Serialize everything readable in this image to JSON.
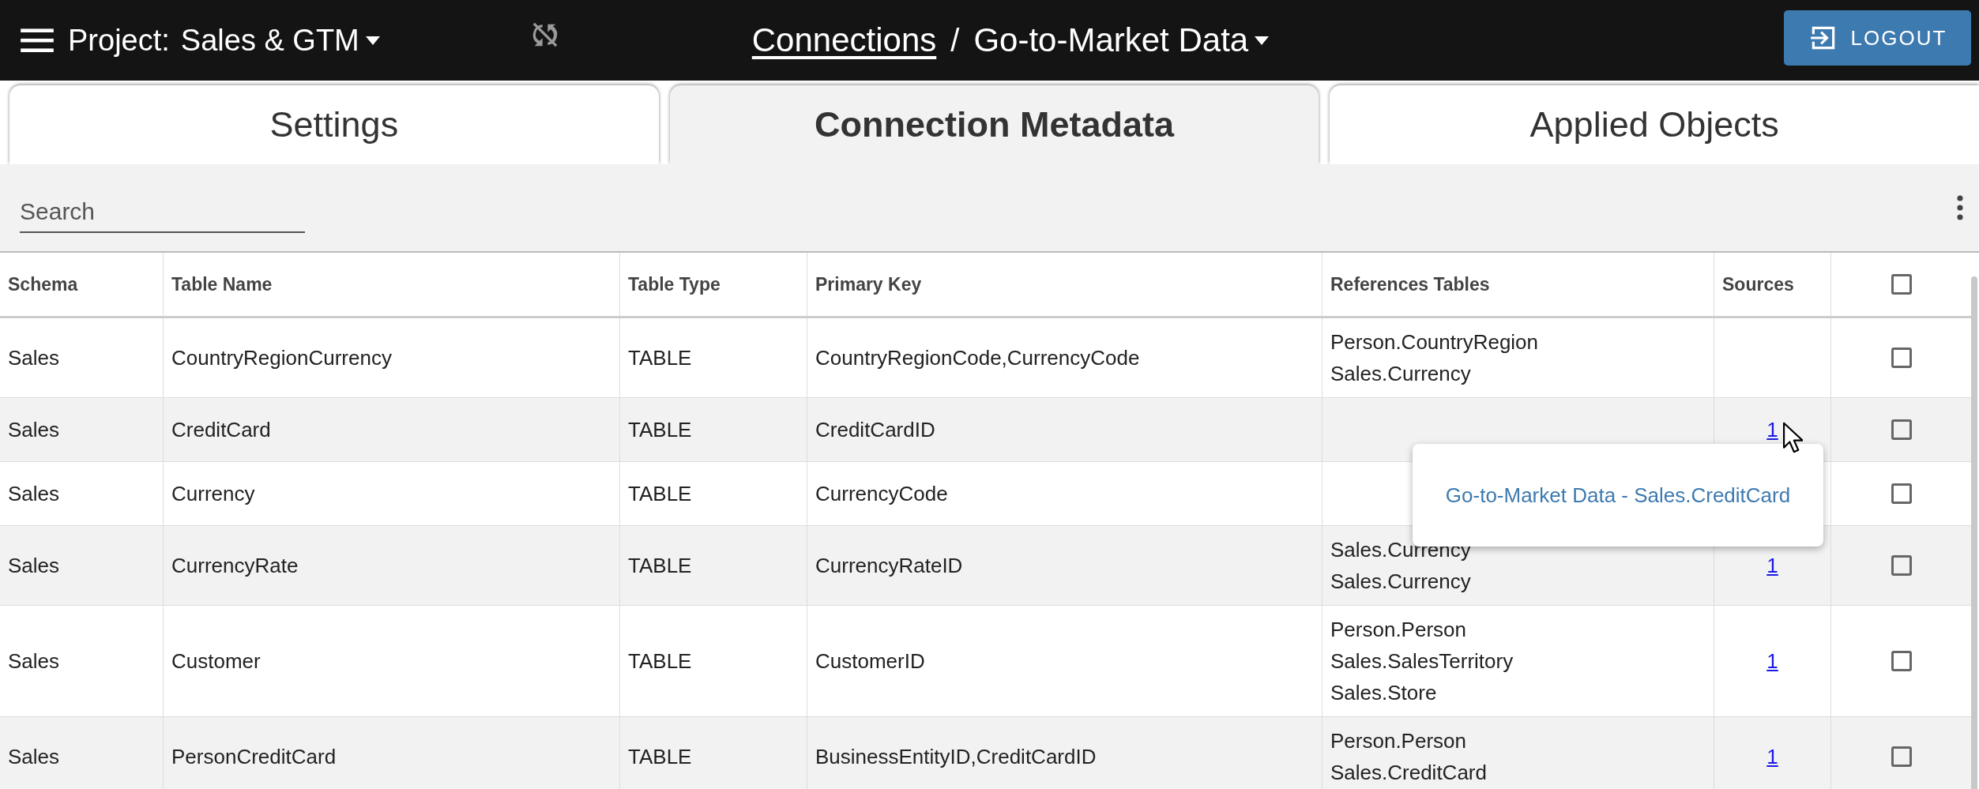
{
  "top_bar": {
    "project_label": "Project:",
    "project_name": "Sales & GTM",
    "breadcrumb_link": "Connections",
    "separator": "/",
    "connection_name": "Go-to-Market Data",
    "logout": "LOGOUT"
  },
  "tabs": [
    {
      "label": "Settings",
      "selected": false
    },
    {
      "label": "Connection Metadata",
      "selected": true
    },
    {
      "label": "Applied Objects",
      "selected": false
    }
  ],
  "search": {
    "placeholder": "Search"
  },
  "table": {
    "columns": [
      "Schema",
      "Table Name",
      "Table Type",
      "Primary Key",
      "References Tables",
      "Sources"
    ],
    "all_checked": false,
    "rows": [
      {
        "schema": "Sales",
        "table_name": "CountryRegionCurrency",
        "table_type": "TABLE",
        "primary_key": "CountryRegionCode,CurrencyCode",
        "references": [
          "Person.CountryRegion",
          "Sales.Currency"
        ],
        "checked": false
      },
      {
        "schema": "Sales",
        "table_name": "CreditCard",
        "table_type": "TABLE",
        "primary_key": "CreditCardID",
        "references": [],
        "sources": "1",
        "checked": false
      },
      {
        "schema": "Sales",
        "table_name": "Currency",
        "table_type": "TABLE",
        "primary_key": "CurrencyCode",
        "references": [],
        "checked": false
      },
      {
        "schema": "Sales",
        "table_name": "CurrencyRate",
        "table_type": "TABLE",
        "primary_key": "CurrencyRateID",
        "references": [
          "Sales.Currency",
          "Sales.Currency"
        ],
        "sources": "1",
        "checked": false
      },
      {
        "schema": "Sales",
        "table_name": "Customer",
        "table_type": "TABLE",
        "primary_key": "CustomerID",
        "references": [
          "Person.Person",
          "Sales.SalesTerritory",
          "Sales.Store"
        ],
        "sources": "1",
        "checked": false
      },
      {
        "schema": "Sales",
        "table_name": "PersonCreditCard",
        "table_type": "TABLE",
        "primary_key": "BusinessEntityID,CreditCardID",
        "references": [
          "Person.Person",
          "Sales.CreditCard"
        ],
        "sources": "1",
        "checked": false
      }
    ]
  },
  "popover": {
    "link": "Go-to-Market Data - Sales.CreditCard"
  }
}
